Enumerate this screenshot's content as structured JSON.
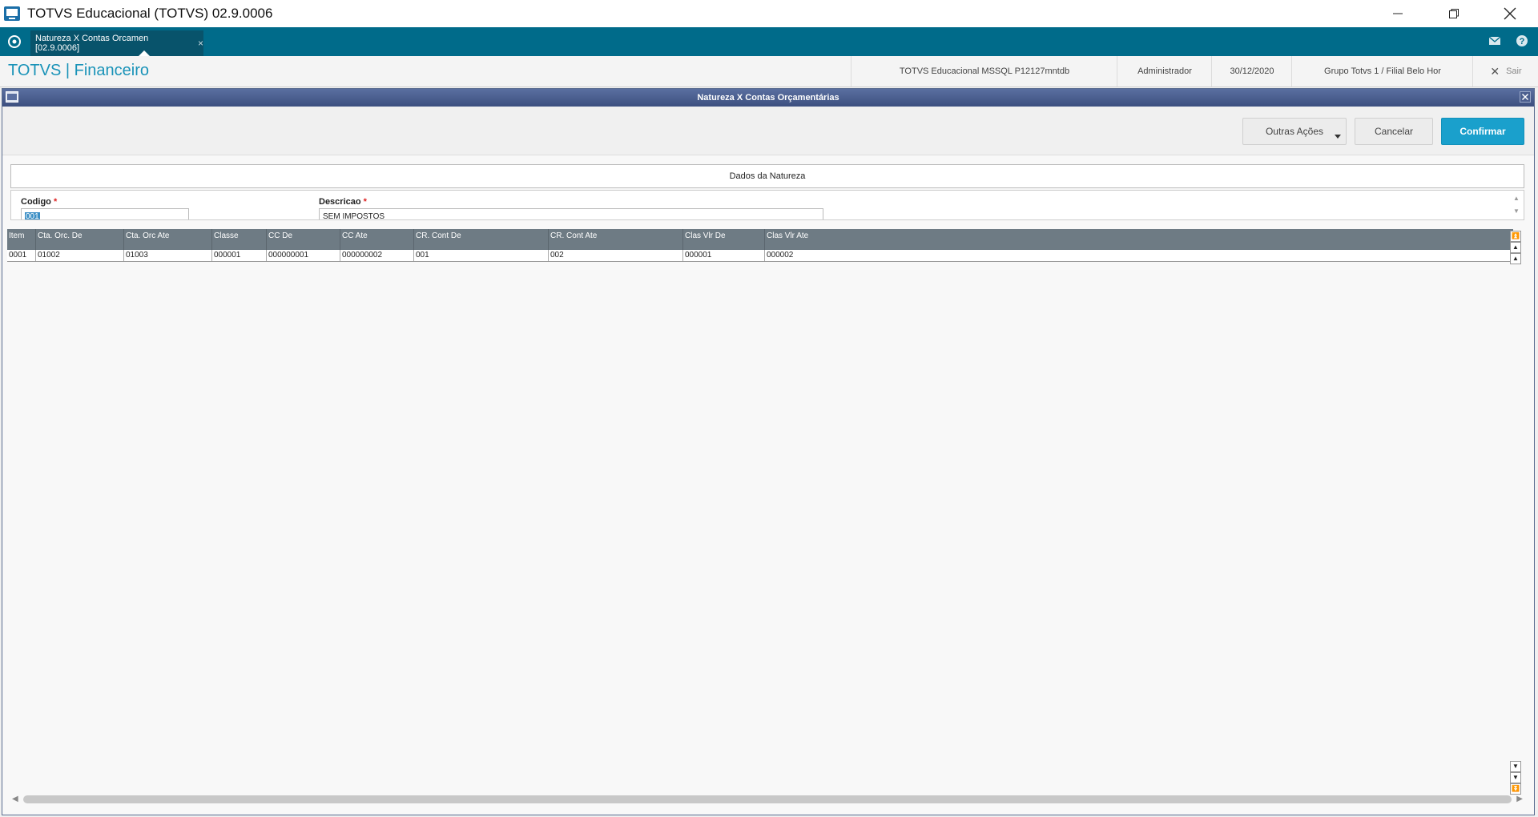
{
  "window": {
    "title": "TOTVS Educacional (TOTVS) 02.9.0006"
  },
  "tabbar": {
    "tab_label": "Natureza X Contas Orcamen [02.9.0006]",
    "tab_close": "×"
  },
  "header": {
    "brand": "TOTVS | Financeiro",
    "environment": "TOTVS Educacional MSSQL P12127mntdb",
    "user": "Administrador",
    "date": "30/12/2020",
    "branch": "Grupo Totvs 1 / Filial Belo Hor",
    "exit_label": "Sair"
  },
  "dialog": {
    "title": "Natureza X Contas Orçamentárias"
  },
  "toolbar": {
    "other_actions": "Outras Ações",
    "cancel": "Cancelar",
    "confirm": "Confirmar"
  },
  "section": {
    "title": "Dados da Natureza"
  },
  "fields": {
    "codigo": {
      "label": "Codigo",
      "value": "001"
    },
    "descricao": {
      "label": "Descricao",
      "value": "SEM IMPOSTOS"
    },
    "required_mark": "*"
  },
  "grid": {
    "columns": [
      "Item",
      "Cta. Orc. De",
      "Cta. Orc Ate",
      "Classe",
      "CC De",
      "CC Ate",
      "CR. Cont De",
      "CR. Cont Ate",
      "Clas Vlr De",
      "Clas Vlr Ate"
    ],
    "rows": [
      [
        "0001",
        "01002",
        "01003",
        "000001",
        "000000001",
        "000000002",
        "001",
        "002",
        "000001",
        "000002"
      ]
    ]
  },
  "colors": {
    "tabbar": "#006b8a",
    "brand": "#1a93b8",
    "confirm_button": "#1aa0cc",
    "dialog_title": "#3c4f7f",
    "grid_header": "#6e7b84"
  }
}
